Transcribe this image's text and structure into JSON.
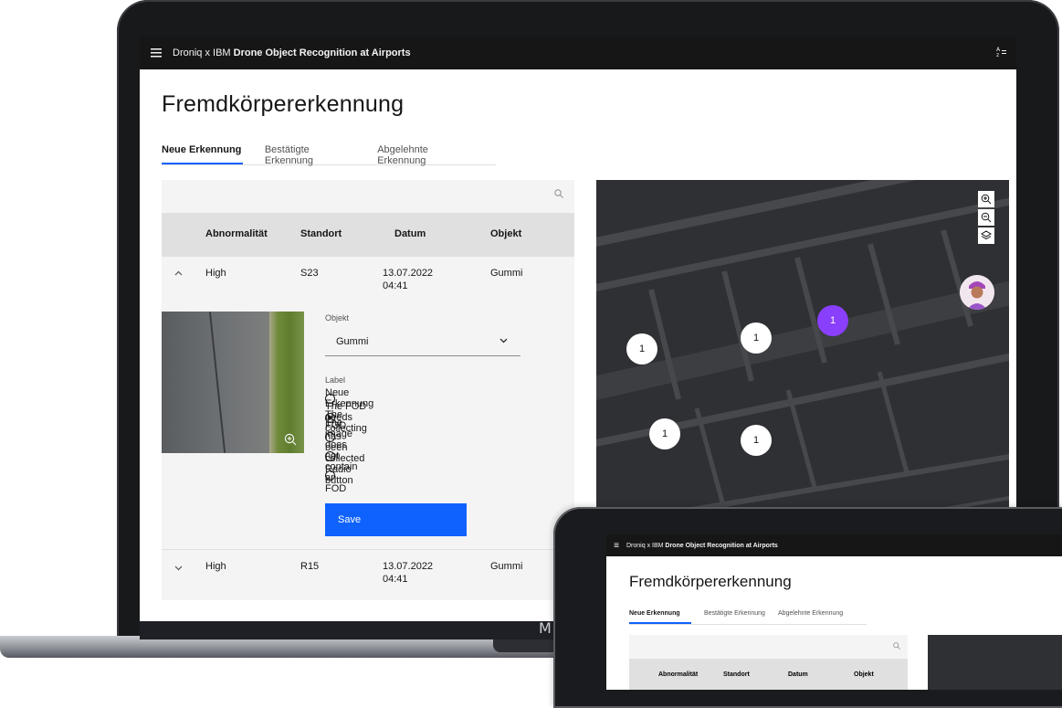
{
  "app": {
    "menu_icon": "hamburger-menu-icon",
    "title_prefix": "Droniq x IBM ",
    "title_bold": "Drone Object Recognition at Airports",
    "switcher_icon": "switcher-icon"
  },
  "page": {
    "title": "Fremdkörpererkennung",
    "tabs": [
      {
        "label": "Neue Erkennung",
        "active": true
      },
      {
        "label": "Bestätigte Erkennung",
        "active": false
      },
      {
        "label": "Abgelehnte Erkennung",
        "active": false
      }
    ]
  },
  "table": {
    "search_icon": "search-icon",
    "headers": [
      "Abnormalität",
      "Standort",
      "Datum",
      "Objekt"
    ],
    "rows": [
      {
        "expanded": true,
        "abnormality": "High",
        "location": "S23",
        "date": "13.07.2022",
        "time": "04:41",
        "object": "Gummi"
      },
      {
        "expanded": false,
        "abnormality": "High",
        "location": "R15",
        "date": "13.07.2022",
        "time": "04:41",
        "object": "Gummi"
      }
    ]
  },
  "detail": {
    "object_label": "Objekt",
    "object_value": "Gummi",
    "label_label": "Label",
    "radio_options": [
      {
        "label": "Neue Erkennung",
        "selected": false
      },
      {
        "label": "The FOD needs collecting",
        "selected": true
      },
      {
        "label": "The FOD has been collected",
        "selected": false
      },
      {
        "label": "The image does not contain an FOD",
        "selected": false
      },
      {
        "label": "Radio button",
        "selected": false
      }
    ],
    "save_label": "Save",
    "zoom_icon": "zoom-in-icon"
  },
  "map": {
    "controls": [
      "zoom-in-icon",
      "zoom-out-icon",
      "layers-icon"
    ],
    "markers": [
      "1",
      "1",
      "1",
      "1",
      "1"
    ],
    "colors": {
      "marker": "#ffffff",
      "marker_active": "#8a3ffc"
    }
  },
  "device": {
    "brand_letter": "M"
  },
  "colors": {
    "accent": "#0f62fe",
    "topbar": "#161616",
    "table_bg": "#f4f4f4",
    "header_bg": "#e0e0e0",
    "map_bg": "#2f3033"
  }
}
